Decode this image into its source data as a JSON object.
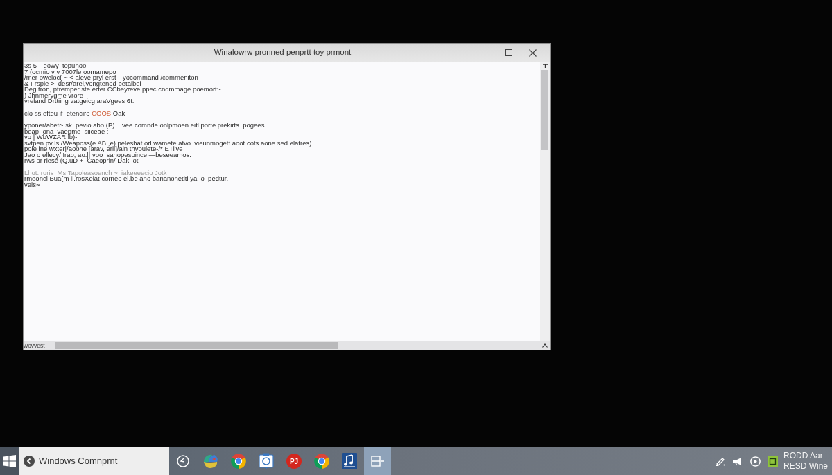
{
  "window": {
    "title": "Winalowrw pronned penprtt toy prmont"
  },
  "console": {
    "paragraphs": [
      [
        {
          "segments": [
            {
              "text": "3s 5—eowy_topunoo",
              "kind": "plain"
            }
          ]
        },
        {
          "segments": [
            {
              "text": "7 (ocmio v v 7007le oomamepo",
              "kind": "plain"
            }
          ]
        },
        {
          "segments": [
            {
              "text": "/mer oweloc( ~ < aleve pryl erst—yocommand /commeniton",
              "kind": "plain"
            }
          ]
        },
        {
          "segments": [
            {
              "text": "& Frspie >  desr/arei,vongtenod betaibei",
              "kind": "plain"
            }
          ]
        },
        {
          "segments": [
            {
              "text": "Deg tron, ptremper ste erter CCbeyreve ppec cndmmage poemort:-",
              "kind": "plain"
            }
          ]
        },
        {
          "segments": [
            {
              "text": ") Jhnmerygme vrore",
              "kind": "plain"
            }
          ]
        },
        {
          "segments": [
            {
              "text": "vreland Drttiing vatgeicg araVgees 6t.",
              "kind": "plain"
            }
          ]
        }
      ],
      [
        {
          "segments": [
            {
              "text": "clo ss efteu if  etenciro ",
              "kind": "plain"
            },
            {
              "text": "COOS",
              "kind": "accent"
            },
            {
              "text": " Oak",
              "kind": "plain"
            }
          ]
        }
      ],
      [
        {
          "segments": [
            {
              "text": "yponer/abetr- sk. pevio abo (P)    vee comnde onlpmoen eitl porte prekirts. pogees .",
              "kind": "plain"
            }
          ]
        },
        {
          "segments": [
            {
              "text": "beap  ona  vaepme  siiceae :",
              "kind": "plain"
            }
          ]
        },
        {
          "segments": [
            {
              "text": "vo | WbWZAR lb)-",
              "kind": "plain"
            }
          ]
        },
        {
          "segments": [
            {
              "text": "svtpen pv ls /Weaposs(e AB.,e) peleshat orl wamete afvo. vieunmogett.aoot cots aone sed elatres)",
              "kind": "plain"
            }
          ]
        },
        {
          "segments": [
            {
              "text": "poie ine wxter|/aoone [arav, eril]/ain thvoulete-/* ETiive",
              "kind": "plain"
            }
          ]
        },
        {
          "segments": [
            {
              "text": "Jao o ellecy/ Irap, ao.|| voo  sanopesoince —beseeamos.",
              "kind": "plain"
            }
          ]
        },
        {
          "segments": [
            {
              "text": "rws or riese (Q.uD +  Caeoprin/ Dak  ot",
              "kind": "plain"
            }
          ]
        }
      ],
      [
        {
          "segments": [
            {
              "text": "Lhot: ruris  Ms Tapoleasoench ~  iakeeeecio Jotk",
              "kind": "dim"
            }
          ]
        },
        {
          "segments": [
            {
              "text": "rmeoncl Bua(m ii.rosXeiat corneo el.be ano bananonetiti ya  o  pedtur.",
              "kind": "plain"
            }
          ]
        },
        {
          "segments": [
            {
              "text": "veis~",
              "kind": "plain"
            }
          ]
        }
      ]
    ]
  },
  "scroll_bar": {
    "label": "wovvest"
  },
  "taskbar": {
    "window_button": {
      "label": "Windows Comnprnt"
    },
    "apps": [
      {
        "selected": false
      },
      {
        "selected": false
      },
      {
        "selected": false
      },
      {
        "selected": false
      },
      {
        "selected": false,
        "label": "PJ"
      },
      {
        "selected": false
      },
      {
        "selected": false
      },
      {
        "selected": true
      }
    ],
    "clock": {
      "time": "RODD Aar",
      "date": "RESD Wine"
    }
  }
}
